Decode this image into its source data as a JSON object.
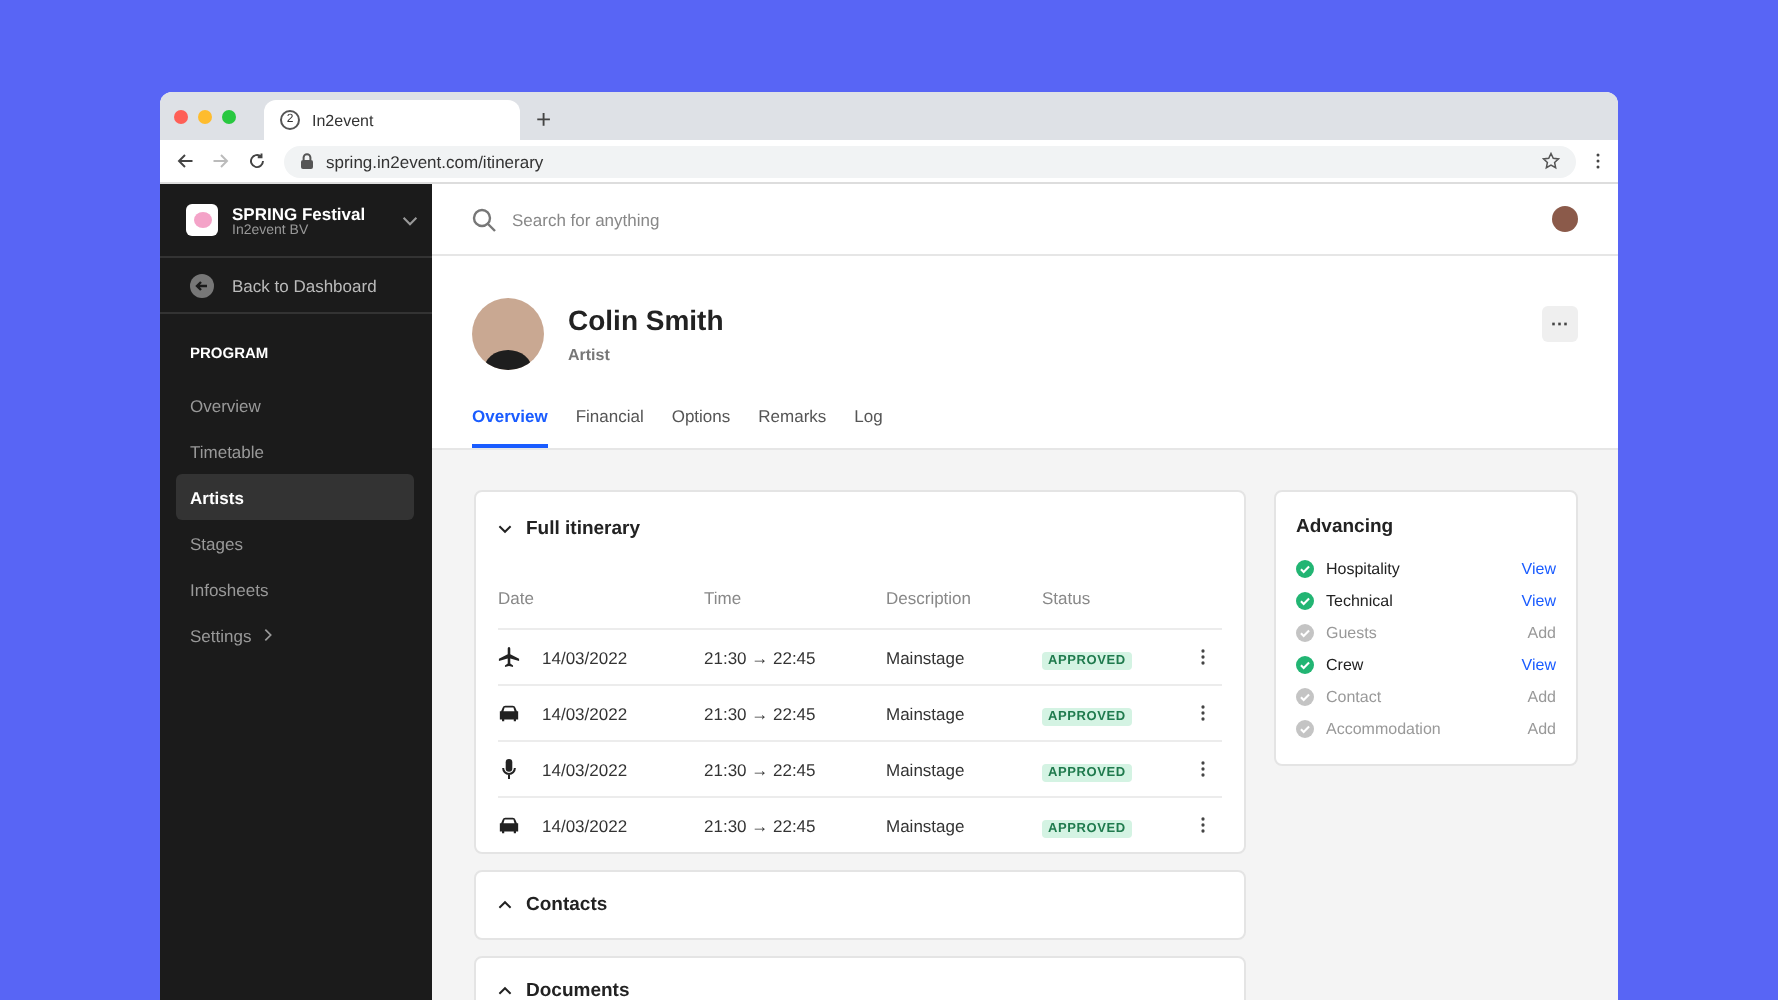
{
  "browser": {
    "tab_title": "In2event",
    "tab_count": "2",
    "new_tab": "+",
    "url": "spring.in2event.com/itinerary"
  },
  "sidebar": {
    "org_name": "SPRING Festival",
    "org_sub": "In2event BV",
    "back": "Back to Dashboard",
    "section": "PROGRAM",
    "items": [
      {
        "label": "Overview",
        "selected": false,
        "has_submenu": false
      },
      {
        "label": "Timetable",
        "selected": false,
        "has_submenu": false
      },
      {
        "label": "Artists",
        "selected": true,
        "has_submenu": false
      },
      {
        "label": "Stages",
        "selected": false,
        "has_submenu": false
      },
      {
        "label": "Infosheets",
        "selected": false,
        "has_submenu": false
      },
      {
        "label": "Settings",
        "selected": false,
        "has_submenu": true
      }
    ]
  },
  "search": {
    "placeholder": "Search for anything"
  },
  "profile": {
    "name": "Colin Smith",
    "role": "Artist",
    "more": "···"
  },
  "tabs": [
    {
      "label": "Overview",
      "selected": true
    },
    {
      "label": "Financial",
      "selected": false
    },
    {
      "label": "Options",
      "selected": false
    },
    {
      "label": "Remarks",
      "selected": false
    },
    {
      "label": "Log",
      "selected": false
    }
  ],
  "itinerary": {
    "title": "Full itinerary",
    "expanded": true,
    "columns": [
      "Date",
      "Time",
      "Description",
      "Status"
    ],
    "rows": [
      {
        "kind": "flight",
        "date": "14/03/2022",
        "time": "21:30 → 22:45",
        "description": "Mainstage",
        "status": "APPROVED"
      },
      {
        "kind": "car",
        "date": "14/03/2022",
        "time": "21:30 → 22:45",
        "description": "Mainstage",
        "status": "APPROVED"
      },
      {
        "kind": "performance",
        "date": "14/03/2022",
        "time": "21:30 → 22:45",
        "description": "Mainstage",
        "status": "APPROVED"
      },
      {
        "kind": "car",
        "date": "14/03/2022",
        "time": "21:30 → 22:45",
        "description": "Mainstage",
        "status": "APPROVED"
      }
    ]
  },
  "sections": [
    {
      "title": "Contacts",
      "expanded": false
    },
    {
      "title": "Documents",
      "expanded": false
    }
  ],
  "advancing": {
    "title": "Advancing",
    "items": [
      {
        "label": "Hospitality",
        "done": true,
        "action": "View"
      },
      {
        "label": "Technical",
        "done": true,
        "action": "View"
      },
      {
        "label": "Guests",
        "done": false,
        "action": "Add"
      },
      {
        "label": "Crew",
        "done": true,
        "action": "View"
      },
      {
        "label": "Contact",
        "done": false,
        "action": "Add"
      },
      {
        "label": "Accommodation",
        "done": false,
        "action": "Add"
      }
    ]
  }
}
